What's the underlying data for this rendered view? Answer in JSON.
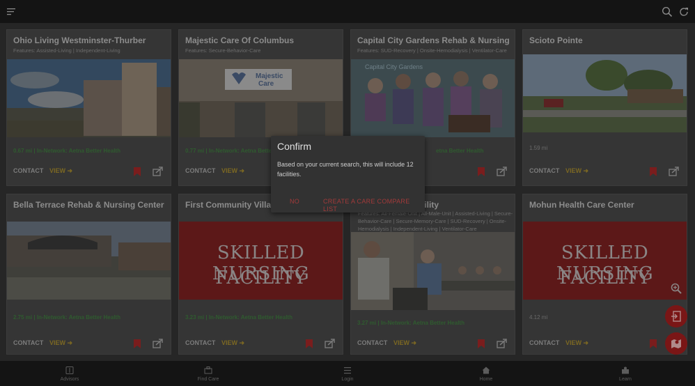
{
  "topbar": {
    "menu_icon": "menu-icon",
    "search_icon": "search-icon",
    "refresh_icon": "refresh-icon"
  },
  "cards": [
    {
      "name": "Ohio Living Westminster-Thurber",
      "features": "Features: Assisted-Living | Independent-Living",
      "distance": "0.67 mi",
      "network": "In-Network: Aetna Better Health",
      "meta": "0.67 mi | In-Network: Aetna Better Health",
      "contact": "CONTACT",
      "view": "VIEW ➜"
    },
    {
      "name": "Majestic Care Of Columbus",
      "features": "Features: Secure-Behavior-Care",
      "sign_line1": "Majestic",
      "sign_line2": "Care",
      "meta": "0.77 mi | In-Network: Aetna Better Health",
      "contact": "CONTACT",
      "view": "VIEW ➜"
    },
    {
      "name": "Capital City Gardens Rehab & Nursing Ce",
      "features": "Features: SUD-Recovery | Onsite-Hemodialysis | Ventilator-Care",
      "photo_text": "Capital City Gardens",
      "meta_right": "etna Better Health",
      "contact": "",
      "view": ""
    },
    {
      "name": "Scioto Pointe",
      "features": "",
      "meta": "1.59 mi",
      "contact": "CONTACT",
      "view": "VIEW ➜"
    },
    {
      "name": "Bella Terrace Rehab & Nursing Center",
      "features": "",
      "meta": "2.75 mi | In-Network: Aetna Better Health",
      "contact": "CONTACT",
      "view": "VIEW ➜"
    },
    {
      "name": "First Community Village",
      "features": "",
      "photo_line1": "SKILLED NURSING",
      "photo_line2": "FACILITY",
      "meta": "3.23 mi | In-Network: Aetna Better Health",
      "contact": "CONTACT",
      "view": "VIEW ➜"
    },
    {
      "name_tail": "acility",
      "features_tail": "Features: All-Female-Unit | All-Male-Unit | Assisted-Living | Secure-",
      "features_line2": "Behavior-Care | Secure-Memory-Care | SUD-Recovery | Onsite-",
      "features_line3": "Hemodialysis | Independent-Living | Ventilator-Care",
      "meta": "3.27 mi | In-Network: Aetna Better Health",
      "contact": "CONTACT",
      "view": "VIEW ➜"
    },
    {
      "name": "Mohun Health Care Center",
      "features": "",
      "photo_line1": "SKILLED NURSING",
      "photo_line2": "FACILITY",
      "meta": "4.12 mi",
      "contact": "CONTACT",
      "view": "VIEW ➜"
    }
  ],
  "dialog": {
    "title": "Confirm",
    "message": "Based on your current search, this will include 12 facilities.",
    "no_label": "NO",
    "confirm_label": "CREATE A CARE COMPARE LIST"
  },
  "bottom_nav": [
    {
      "label": "Advisors",
      "icon": "advisors-icon"
    },
    {
      "label": "Find Care",
      "icon": "find-care-icon"
    },
    {
      "label": "Login",
      "icon": "login-icon"
    },
    {
      "label": "Home",
      "icon": "home-icon"
    },
    {
      "label": "Learn",
      "icon": "learn-icon"
    }
  ],
  "fabs": {
    "zoom": "zoom-in-icon",
    "export": "export-list-icon",
    "map": "map-icon"
  },
  "colors": {
    "bookmark": "#7a1d1d",
    "fab": "#7a1616",
    "dialog_button": "#a33a3a",
    "in_network": "#2f5b2f",
    "view": "#7c6822"
  }
}
